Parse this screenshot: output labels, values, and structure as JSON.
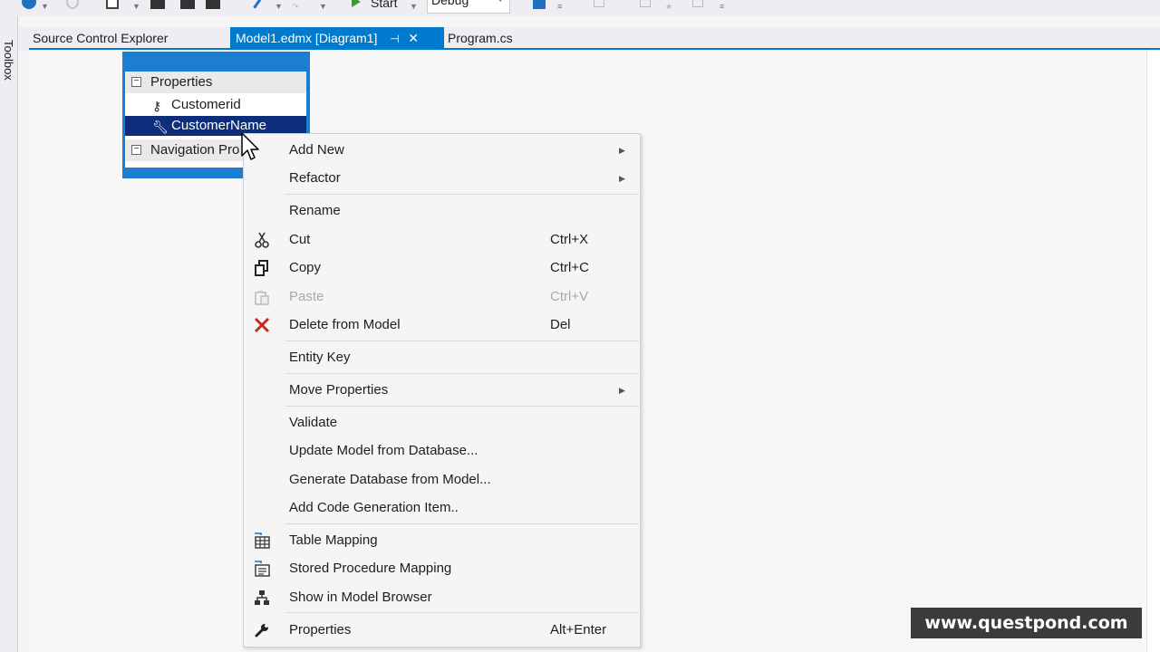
{
  "toolbar": {
    "start_label": "Start",
    "config_value": "Debug"
  },
  "toolbox": {
    "label": "Toolbox"
  },
  "tabs": [
    {
      "label": "Source Control Explorer"
    },
    {
      "label": "Model1.edmx [Diagram1]"
    },
    {
      "label": "Program.cs"
    }
  ],
  "entity": {
    "properties_header": "Properties",
    "properties": [
      "Customerid",
      "CustomerName"
    ],
    "navigation_header": "Navigation Pro"
  },
  "context_menu": {
    "add_new": "Add New",
    "refactor": "Refactor",
    "rename": "Rename",
    "cut": "Cut",
    "cut_shortcut": "Ctrl+X",
    "copy": "Copy",
    "copy_shortcut": "Ctrl+C",
    "paste": "Paste",
    "paste_shortcut": "Ctrl+V",
    "delete": "Delete from Model",
    "delete_shortcut": "Del",
    "entity_key": "Entity Key",
    "move_properties": "Move Properties",
    "validate": "Validate",
    "update_model": "Update Model from Database...",
    "generate_db": "Generate Database from Model...",
    "add_codegen": "Add Code Generation Item..",
    "table_mapping": "Table Mapping",
    "stored_proc_mapping": "Stored Procedure Mapping",
    "show_model_browser": "Show in Model Browser",
    "properties": "Properties",
    "properties_shortcut": "Alt+Enter"
  },
  "watermark": "www.questpond.com",
  "colors": {
    "accent": "#007acc",
    "selection": "#0d2f7b",
    "delete_red": "#c42b1c"
  }
}
